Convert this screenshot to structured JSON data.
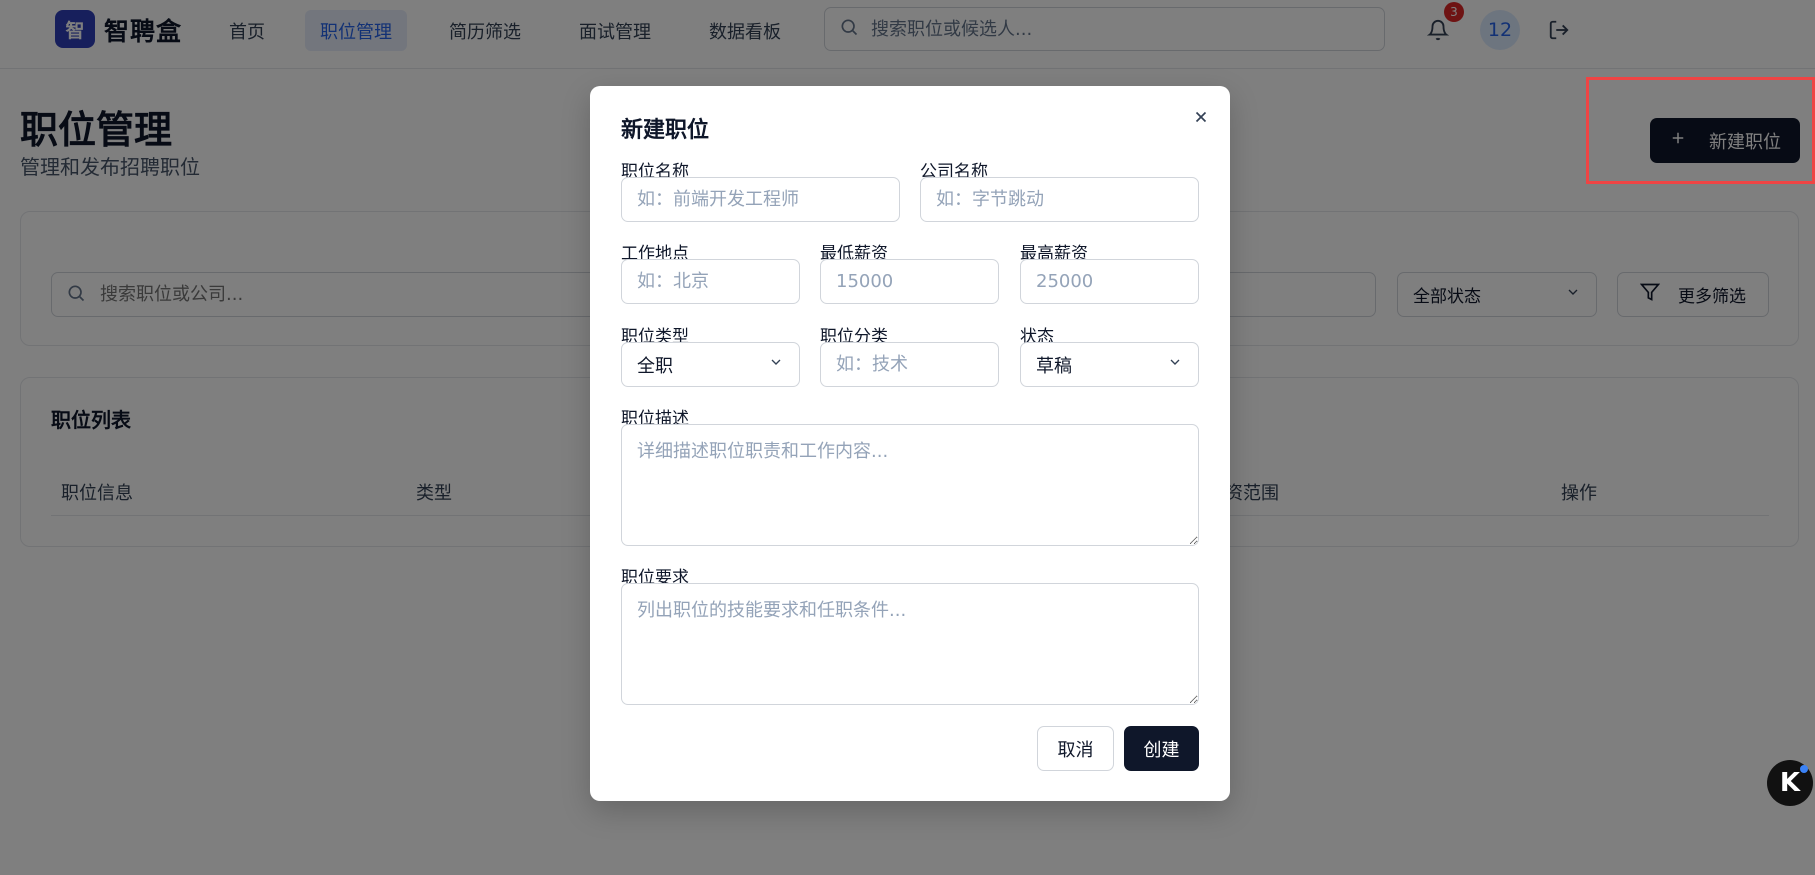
{
  "header": {
    "logo_char": "智",
    "app_name": "智聘盒",
    "nav": [
      {
        "label": "首页"
      },
      {
        "label": "职位管理"
      },
      {
        "label": "简历筛选"
      },
      {
        "label": "面试管理"
      },
      {
        "label": "数据看板"
      }
    ],
    "active_nav": "职位管理",
    "search_placeholder": "搜索职位或候选人...",
    "notification_count": "3",
    "avatar_text": "12"
  },
  "page": {
    "title": "职位管理",
    "subtitle": "管理和发布招聘职位",
    "new_job_label": "新建职位"
  },
  "filters": {
    "search_placeholder": "搜索职位或公司...",
    "status_value": "全部状态",
    "more_filters_label": "更多筛选"
  },
  "job_list": {
    "title": "职位列表",
    "columns": {
      "info": "职位信息",
      "type": "类型",
      "salary": "资范围",
      "actions": "操作"
    }
  },
  "modal": {
    "title": "新建职位",
    "fields": {
      "job_title": {
        "label": "职位名称",
        "placeholder": "如：前端开发工程师"
      },
      "company": {
        "label": "公司名称",
        "placeholder": "如：字节跳动"
      },
      "location": {
        "label": "工作地点",
        "placeholder": "如：北京"
      },
      "min_salary": {
        "label": "最低薪资",
        "placeholder": "15000"
      },
      "max_salary": {
        "label": "最高薪资",
        "placeholder": "25000"
      },
      "job_type": {
        "label": "职位类型",
        "value": "全职"
      },
      "category": {
        "label": "职位分类",
        "placeholder": "如：技术"
      },
      "status": {
        "label": "状态",
        "value": "草稿"
      },
      "description": {
        "label": "职位描述",
        "placeholder": "详细描述职位职责和工作内容..."
      },
      "requirements": {
        "label": "职位要求",
        "placeholder": "列出职位的技能要求和任职条件..."
      }
    },
    "cancel_label": "取消",
    "create_label": "创建"
  },
  "floating_badge": {
    "label": "K"
  },
  "colors": {
    "primary_dark": "#0f172a",
    "brand": "#2f3fb8",
    "active_nav_bg": "#e6ecfa",
    "active_nav_text": "#2563eb",
    "notification": "#dc2626",
    "highlight": "#ef4444"
  }
}
